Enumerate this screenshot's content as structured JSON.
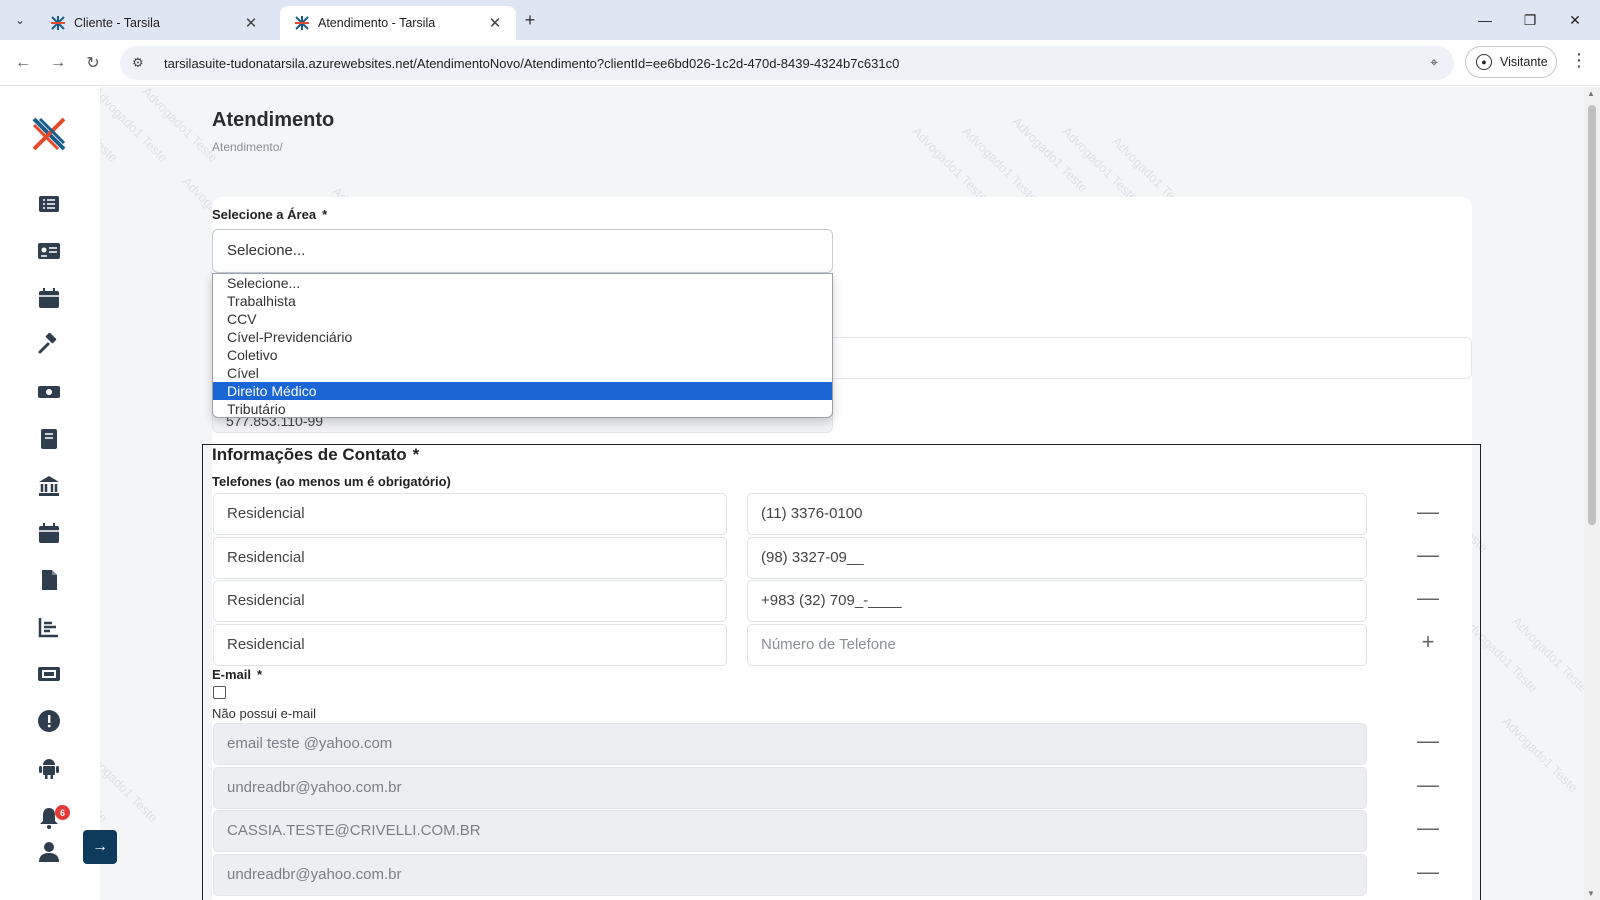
{
  "browser": {
    "tabs": [
      {
        "title": "Cliente - Tarsila",
        "active": false
      },
      {
        "title": "Atendimento - Tarsila",
        "active": true
      }
    ],
    "url": "tarsilasuite-tudonatarsila.azurewebsites.net/AtendimentoNovo/Atendimento?clientId=ee6bd026-1c2d-470d-8439-4324b7c631c0",
    "profile_label": "Visitante"
  },
  "sidebar": {
    "icons": [
      "list-icon",
      "id-card-icon",
      "calendar-icon",
      "gavel-icon",
      "money-icon",
      "book-icon",
      "bank-icon",
      "calendar-alt-icon",
      "document-icon",
      "chart-icon",
      "ticket-icon",
      "alert-icon",
      "android-icon",
      "bell-icon",
      "user-icon"
    ],
    "notification_count": "6"
  },
  "watermark_text": "Advogado1 Teste",
  "page": {
    "title": "Atendimento",
    "breadcrumb": "Atendimento/"
  },
  "area": {
    "label": "Selecione a Área",
    "required": "*",
    "selected": "Selecione...",
    "options": [
      "Selecione...",
      "Trabalhista",
      "CCV",
      "Cível-Previdenciário",
      "Coletivo",
      "Cível",
      "Direito Médico",
      "Tributário"
    ],
    "highlighted_index": 6
  },
  "cpf_value": "577.853.110-99",
  "contact": {
    "title": "Informações de Contato",
    "required": "*",
    "phones_label": "Telefones (ao menos um é obrigatório)",
    "phones": [
      {
        "type": "Residencial",
        "number": "(11) 3376-0100"
      },
      {
        "type": "Residencial",
        "number": "(98) 3327-09__"
      },
      {
        "type": "Residencial",
        "number": "+983 (32) 709_-____"
      },
      {
        "type": "Residencial",
        "number": ""
      }
    ],
    "phone_placeholder": "Número de Telefone",
    "email_label": "E-mail",
    "email_required": "*",
    "no_email_label": "Não possui e-mail",
    "emails": [
      "email teste @yahoo.com",
      "undreadbr@yahoo.com.br",
      "CASSIA.TESTE@CRIVELLI.COM.BR",
      "undreadbr@yahoo.com.br"
    ]
  }
}
